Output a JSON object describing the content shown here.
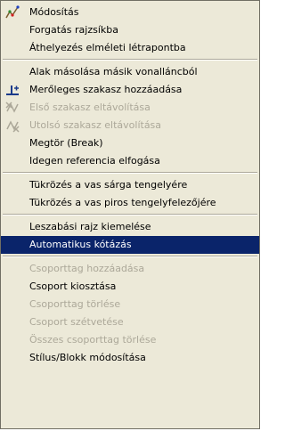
{
  "menu": {
    "items": [
      {
        "label": "Módosítás",
        "disabled": false,
        "icon": "edit-polyline-icon"
      },
      {
        "label": "Forgatás rajzsíkba",
        "disabled": false
      },
      {
        "label": "Áthelyezés elméleti létrapontba",
        "disabled": false
      },
      {
        "label": "Alak másolása másik vonalláncból",
        "disabled": false
      },
      {
        "label": "Merőleges szakasz hozzáadása",
        "disabled": false,
        "icon": "add-perpendicular-segment-icon"
      },
      {
        "label": "Első szakasz eltávolítása",
        "disabled": true,
        "icon": "remove-first-segment-icon"
      },
      {
        "label": "Utolsó szakasz eltávolítása",
        "disabled": true,
        "icon": "remove-last-segment-icon"
      },
      {
        "label": "Megtör (Break)",
        "disabled": false
      },
      {
        "label": "Idegen referencia elfogása",
        "disabled": false
      },
      {
        "label": "Tükrözés a vas sárga tengelyére",
        "disabled": false
      },
      {
        "label": "Tükrözés a vas piros tengelyfelezőjére",
        "disabled": false
      },
      {
        "label": "Leszabási rajz kiemelése",
        "disabled": false
      },
      {
        "label": "Automatikus kótázás",
        "disabled": false,
        "highlighted": true
      },
      {
        "label": "Csoporttag hozzáadása",
        "disabled": true
      },
      {
        "label": "Csoport kiosztása",
        "disabled": false
      },
      {
        "label": "Csoporttag törlése",
        "disabled": true
      },
      {
        "label": "Csoport szétvetése",
        "disabled": true
      },
      {
        "label": "Összes csoporttag törlése",
        "disabled": true
      },
      {
        "label": "Stílus/Blokk módosítása",
        "disabled": false
      }
    ],
    "colors": {
      "background": "#ece9d8",
      "highlight": "#0a246a",
      "disabled_text": "#aca899"
    }
  }
}
